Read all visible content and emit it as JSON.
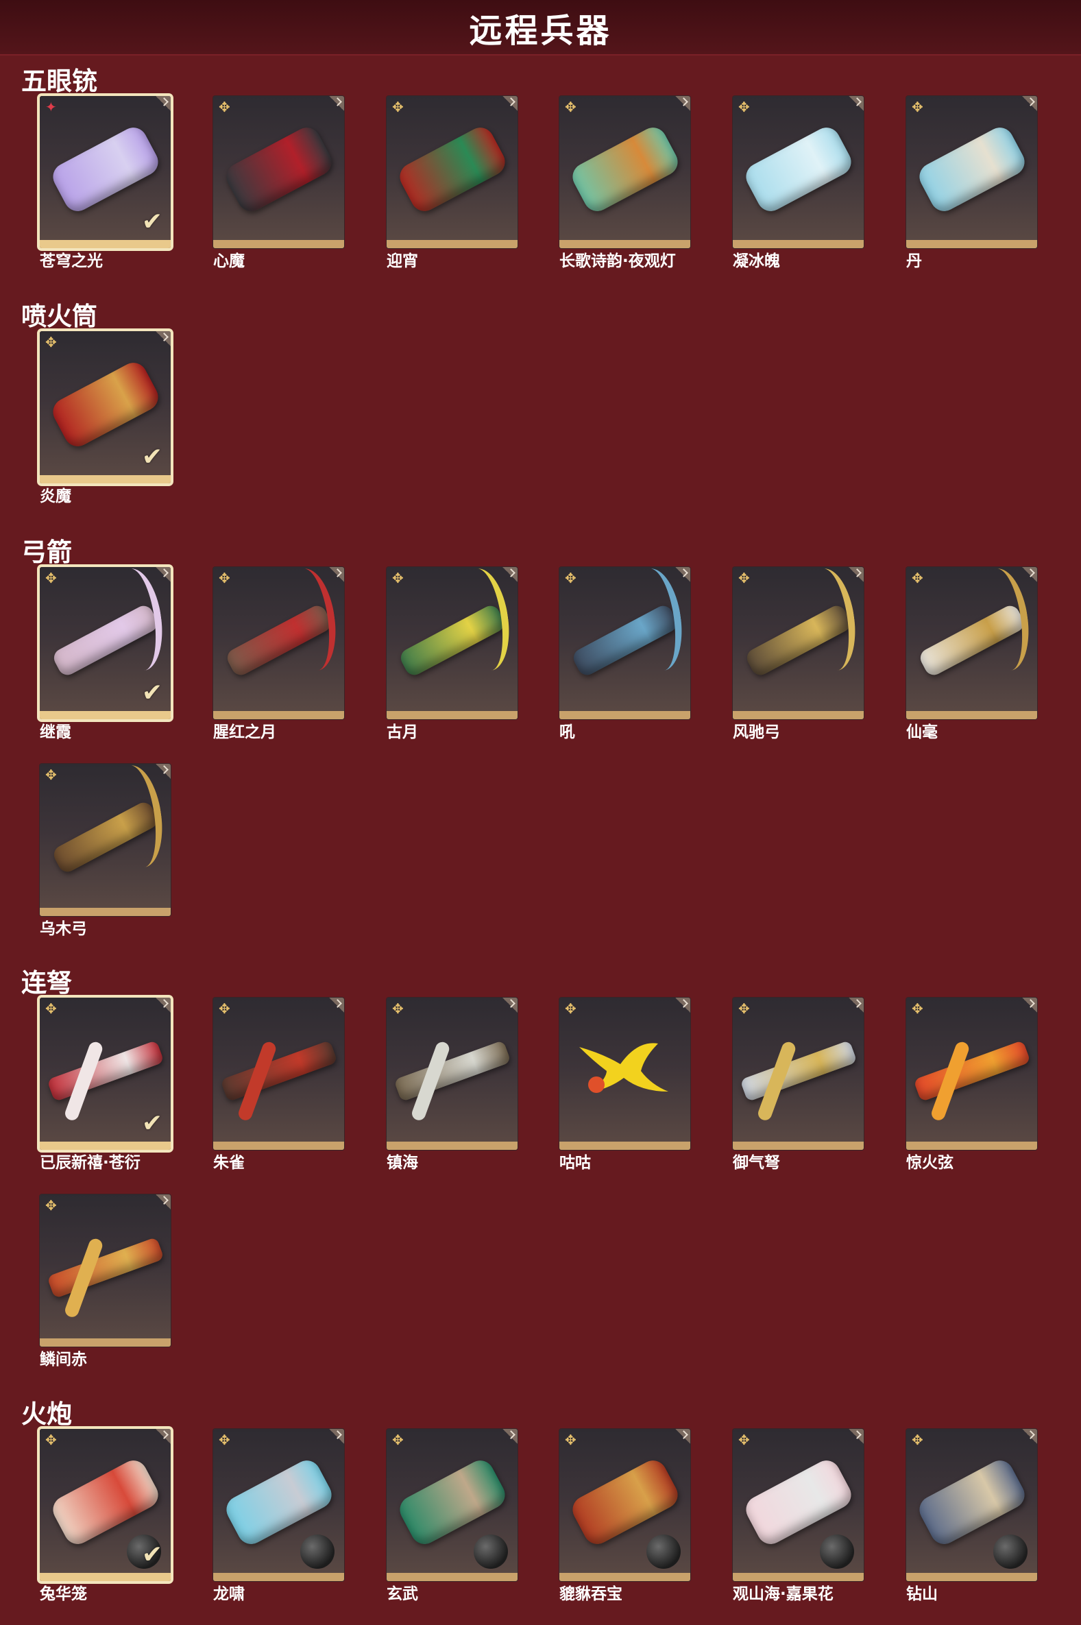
{
  "header": {
    "title": "远程兵器"
  },
  "sections": [
    {
      "title": "五眼铳",
      "items": [
        {
          "name": "苍穹之光",
          "selected": true,
          "badge": "star",
          "colors": [
            "#b7a0e8",
            "#d8d0f0"
          ]
        },
        {
          "name": "心魔",
          "colors": [
            "#3a3a3f",
            "#b1202a"
          ]
        },
        {
          "name": "迎宵",
          "colors": [
            "#b52a22",
            "#2b8a55"
          ]
        },
        {
          "name": "长歌诗韵·夜观灯",
          "colors": [
            "#6fc6a8",
            "#d78a3a"
          ]
        },
        {
          "name": "凝冰魄",
          "colors": [
            "#a8dcec",
            "#e0f2f7"
          ]
        },
        {
          "name": "丹",
          "colors": [
            "#8fd1e6",
            "#e6e0d0"
          ]
        }
      ]
    },
    {
      "title": "喷火筒",
      "items": [
        {
          "name": "炎魔",
          "selected": true,
          "colors": [
            "#b02020",
            "#d9a24a"
          ]
        }
      ]
    },
    {
      "title": "弓箭",
      "items": [
        {
          "name": "继霞",
          "selected": true,
          "kind": "bow",
          "colors": [
            "#d3b6c8",
            "#e2c9e8"
          ]
        },
        {
          "name": "腥红之月",
          "kind": "bow",
          "colors": [
            "#7a5a4a",
            "#c03030"
          ]
        },
        {
          "name": "古月",
          "kind": "bow",
          "colors": [
            "#3d7a4a",
            "#e3d246"
          ]
        },
        {
          "name": "吼",
          "kind": "bow",
          "colors": [
            "#3d4a5e",
            "#6aa6c8"
          ]
        },
        {
          "name": "风驰弓",
          "kind": "bow",
          "colors": [
            "#5a4a38",
            "#d8b65a"
          ]
        },
        {
          "name": "仙毫",
          "kind": "bow",
          "colors": [
            "#e8e4dc",
            "#c9a04a"
          ]
        },
        {
          "name": "乌木弓",
          "kind": "bow",
          "colors": [
            "#6a4a2e",
            "#c9a04a"
          ]
        }
      ]
    },
    {
      "title": "连弩",
      "items": [
        {
          "name": "已辰新禧·苍衍",
          "selected": true,
          "kind": "xbow",
          "colors": [
            "#c2303a",
            "#f0e6e6"
          ]
        },
        {
          "name": "朱雀",
          "kind": "xbow",
          "colors": [
            "#5a3a30",
            "#c23a2a"
          ]
        },
        {
          "name": "镇海",
          "kind": "xbow",
          "colors": [
            "#7a6a52",
            "#d8d8d0"
          ]
        },
        {
          "name": "咕咕",
          "kind": "chicken",
          "colors": [
            "#f2d21e",
            "#e0502a"
          ]
        },
        {
          "name": "御气弩",
          "kind": "xbow",
          "colors": [
            "#cfd6e2",
            "#d8b65a"
          ]
        },
        {
          "name": "惊火弦",
          "kind": "xbow",
          "colors": [
            "#e2482a",
            "#f0a030"
          ]
        },
        {
          "name": "鳞间赤",
          "kind": "xbow",
          "colors": [
            "#c84a2a",
            "#e0b050"
          ]
        }
      ]
    },
    {
      "title": "火炮",
      "items": [
        {
          "name": "兔华笼",
          "selected": true,
          "ball": true,
          "colors": [
            "#f0d8c8",
            "#d84a3a"
          ]
        },
        {
          "name": "龙啸",
          "ball": true,
          "colors": [
            "#7ad0e6",
            "#c8ccd4"
          ]
        },
        {
          "name": "玄武",
          "ball": true,
          "colors": [
            "#2a8a68",
            "#bfa88a"
          ]
        },
        {
          "name": "貔貅吞宝",
          "ball": true,
          "colors": [
            "#b03a22",
            "#d8a04a"
          ]
        },
        {
          "name": "观山海·嘉果花",
          "ball": true,
          "colors": [
            "#f2d6dc",
            "#e8e8e8"
          ]
        },
        {
          "name": "钻山",
          "ball": true,
          "colors": [
            "#5a6a8a",
            "#d8c8a8"
          ]
        }
      ]
    }
  ]
}
